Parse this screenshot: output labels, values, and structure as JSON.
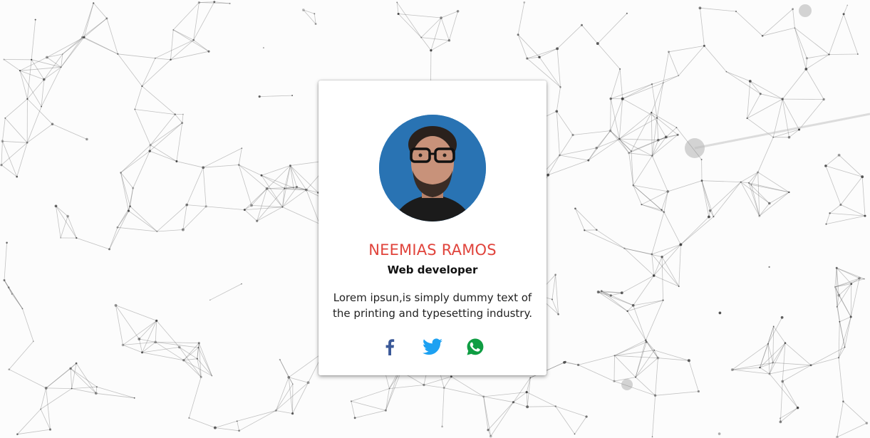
{
  "profile": {
    "name": "NEEMIAS RAMOS",
    "role": "Web developer",
    "bio": "Lorem ipsun,is simply dummy text of the printing and typesetting industry."
  },
  "social": [
    {
      "icon": "facebook-icon",
      "color": "#3b5998"
    },
    {
      "icon": "twitter-icon",
      "color": "#1da1f2"
    },
    {
      "icon": "whatsapp-icon",
      "color": "#0f9d43"
    }
  ],
  "colors": {
    "name": "#e0443c",
    "avatar_bg": "#2f7fc0"
  }
}
